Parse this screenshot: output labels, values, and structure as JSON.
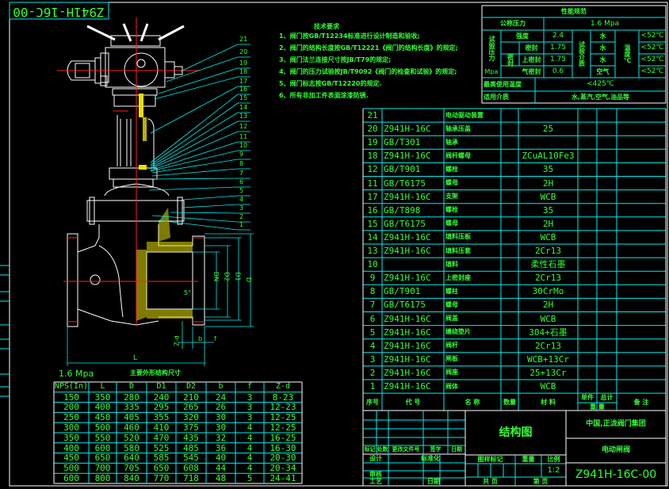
{
  "title_stamp": "Z941H-16C-00",
  "tech_requirements": {
    "title": "技术要求",
    "items": [
      "1、阀门按GB/T12234标准进行设计制造和验收;",
      "2、阀门的结构长度按GB/T12221《阀门的结构长度》的规定;",
      "3、阀门法兰连接尺寸按JB/T79的规定;",
      "4、阀门的压力试验按JB/T9092《阀门的检查和试验》的规定;",
      "5、阀门标志按GB/T12220的规定.",
      "6、所有非加工件表面涂漆防锈."
    ]
  },
  "performance": {
    "title": "性能规范",
    "nominal_pressure_label": "公称压力",
    "nominal_pressure": "1.6 Mpa",
    "test_pressure_label": "试验压力",
    "test_pressure_unit": "Mpa",
    "seal_label": "密封",
    "rows": [
      {
        "label": "强度",
        "value": "2.4",
        "medium": "水",
        "temp": "<52℃"
      },
      {
        "label": "密封",
        "value": "1.75",
        "medium": "水",
        "temp": "<52℃"
      },
      {
        "label": "上密封",
        "value": "1.75",
        "medium": "水",
        "temp": "<52℃"
      },
      {
        "label": "气密封",
        "value": "0.6",
        "medium": "空气",
        "temp": "<52℃"
      }
    ],
    "test_medium_label": "试验介质",
    "temp_label": "温度℃",
    "max_temp_label": "最高使用温度",
    "max_temp": "<425℃",
    "applicable_medium_label": "适用介质",
    "applicable_medium": "水,蒸汽,空气,油品等"
  },
  "parts": {
    "rows": [
      {
        "no": "21",
        "code": "",
        "name": "电动驱动装置",
        "material": ""
      },
      {
        "no": "20",
        "code": "Z941H-16C",
        "name": "轴承压盖",
        "material": "25"
      },
      {
        "no": "19",
        "code": "GB/T301",
        "name": "轴承",
        "material": ""
      },
      {
        "no": "18",
        "code": "Z941H-16C",
        "name": "阀杆螺母",
        "material": "ZCuAL10Fe3"
      },
      {
        "no": "12",
        "code": "GB/T901",
        "name": "螺栓",
        "material": "35"
      },
      {
        "no": "11",
        "code": "GB/T6175",
        "name": "螺母",
        "material": "2H"
      },
      {
        "no": "17",
        "code": "Z941H-16C",
        "name": "支架",
        "material": "WCB"
      },
      {
        "no": "16",
        "code": "GB/T898",
        "name": "螺栓",
        "material": "35"
      },
      {
        "no": "15",
        "code": "GB/T6175",
        "name": "螺母",
        "material": "2H"
      },
      {
        "no": "14",
        "code": "Z941H-16C",
        "name": "填料压板",
        "material": "WCB"
      },
      {
        "no": "13",
        "code": "Z941H-16C",
        "name": "填料压套",
        "material": "2Cr13"
      },
      {
        "no": "10",
        "code": "",
        "name": "填料",
        "material": "柔性石墨"
      },
      {
        "no": "9",
        "code": "Z941H-16C",
        "name": "上密封座",
        "material": "2Cr13"
      },
      {
        "no": "8",
        "code": "GB/T901",
        "name": "螺柱",
        "material": "30CrMo"
      },
      {
        "no": "7",
        "code": "GB/T6175",
        "name": "螺母",
        "material": "2H"
      },
      {
        "no": "6",
        "code": "Z941H-16C",
        "name": "阀盖",
        "material": "WCB"
      },
      {
        "no": "5",
        "code": "Z941H-16C",
        "name": "缠绕垫片",
        "material": "304+石墨"
      },
      {
        "no": "4",
        "code": "Z941H-16C",
        "name": "阀杆",
        "material": "2Cr13"
      },
      {
        "no": "3",
        "code": "Z941H-16C",
        "name": "闸板",
        "material": "WCB+13Cr"
      },
      {
        "no": "2",
        "code": "Z941H-16C",
        "name": "阀座",
        "material": "25+13Cr"
      },
      {
        "no": "1",
        "code": "Z941H-16C",
        "name": "阀体",
        "material": "WCB"
      }
    ],
    "headers": {
      "no": "序号",
      "code": "代 号",
      "name": "名 称",
      "qty": "数量",
      "material": "材 料",
      "unit": "单件",
      "total": "总计",
      "weight": "重 量",
      "remarks": "备 注"
    }
  },
  "dimensions": {
    "pressure": "1.6 Mpa",
    "title": "主要外形结构尺寸",
    "headers": [
      "NPS(In)",
      "L",
      "D",
      "D1",
      "D2",
      "b",
      "f",
      "Z-d"
    ],
    "rows": [
      [
        "150",
        "350",
        "280",
        "240",
        "210",
        "24",
        "3",
        "8-23"
      ],
      [
        "200",
        "400",
        "335",
        "295",
        "265",
        "26",
        "3",
        "12-23"
      ],
      [
        "250",
        "450",
        "405",
        "355",
        "320",
        "30",
        "3",
        "12-25"
      ],
      [
        "300",
        "500",
        "460",
        "410",
        "375",
        "30",
        "4",
        "12-25"
      ],
      [
        "350",
        "550",
        "520",
        "470",
        "435",
        "32",
        "4",
        "16-25"
      ],
      [
        "400",
        "600",
        "580",
        "525",
        "485",
        "36",
        "4",
        "16-30"
      ],
      [
        "450",
        "650",
        "640",
        "585",
        "545",
        "40",
        "4",
        "20-30"
      ],
      [
        "500",
        "700",
        "705",
        "650",
        "608",
        "44",
        "4",
        "20-34"
      ],
      [
        "600",
        "800",
        "840",
        "770",
        "718",
        "48",
        "5",
        "24-41"
      ]
    ]
  },
  "drawing": {
    "leaders": [
      "21",
      "20",
      "19",
      "18",
      "17",
      "16",
      "15",
      "14",
      "13",
      "12",
      "11",
      "10",
      "9",
      "8",
      "7",
      "6",
      "5",
      "4",
      "3",
      "2",
      "1"
    ],
    "dim_labels": {
      "DN": "DN",
      "D2": "D2",
      "D1": "D1",
      "D": "D",
      "angle": "5°",
      "zd": "Z-d",
      "b": "b",
      "f": "f",
      "L": "L"
    }
  },
  "title_block": {
    "rev_headers": [
      "标记",
      "处数",
      "更改文件号",
      "签字",
      "日期"
    ],
    "design": "设计",
    "standard": "标准化",
    "review": "审核",
    "process": "工艺",
    "date": "日期",
    "drawing_mark": "图样标记",
    "weight": "重量",
    "scale_label": "比例",
    "scale": "1:2",
    "total_pages": "共  页",
    "page": "第  页",
    "drawing_name": "结构图",
    "company": "中国,正泷阀门集团",
    "product": "电动闸阀",
    "drawing_no": "Z941H-16C-00"
  },
  "colors": {
    "line": "#00e5e5",
    "text": "#33ff33",
    "outline": "#ffffff",
    "center": "#ff2020",
    "hatch": "#e8e000"
  }
}
